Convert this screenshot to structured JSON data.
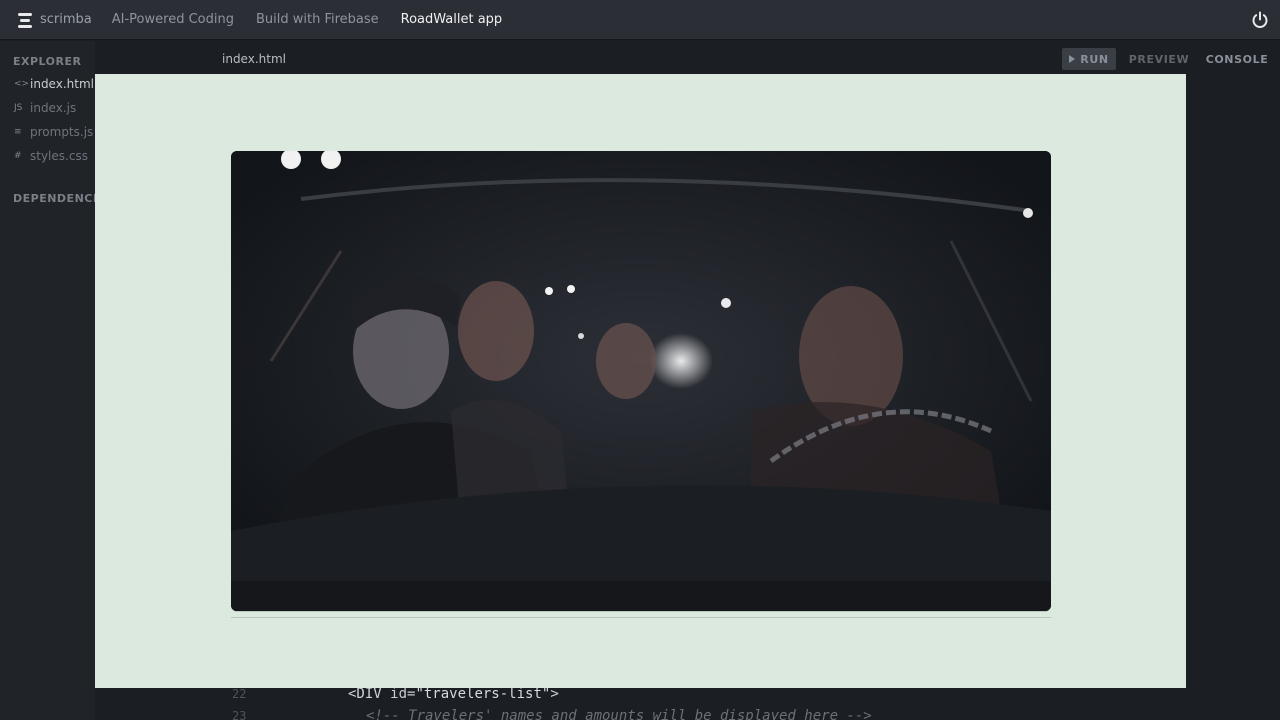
{
  "topbar": {
    "logo_text": "scrimba",
    "breadcrumbs": [
      "AI-Powered Coding",
      "Build with Firebase",
      "RoadWallet app"
    ]
  },
  "sidebar": {
    "explorer_label": "EXPLORER",
    "files": [
      {
        "icon": "<>",
        "name": "index.html"
      },
      {
        "icon": "JS",
        "name": "index.js"
      },
      {
        "icon": "≡",
        "name": "prompts.js"
      },
      {
        "icon": "#",
        "name": "styles.css"
      }
    ],
    "dependencies_label": "DEPENDENCIES"
  },
  "editor": {
    "tab_label": "index.html",
    "run_label": "RUN",
    "preview_label": "PREVIEW",
    "console_label": "CONSOLE",
    "code_lines": [
      {
        "number": "22",
        "tag_open": "<DIV ",
        "attr": "id=",
        "value": "\"travelers-list\"",
        "tag_close": ">"
      },
      {
        "number": "23",
        "comment": "<!-- Travelers' names and amounts will be displayed here -->"
      }
    ]
  },
  "colors": {
    "overlay_background": "#dbe9de",
    "topbar_background": "#2b2f35",
    "editor_background": "#1b1e22"
  },
  "video": {
    "description_icon": "video-frame"
  }
}
